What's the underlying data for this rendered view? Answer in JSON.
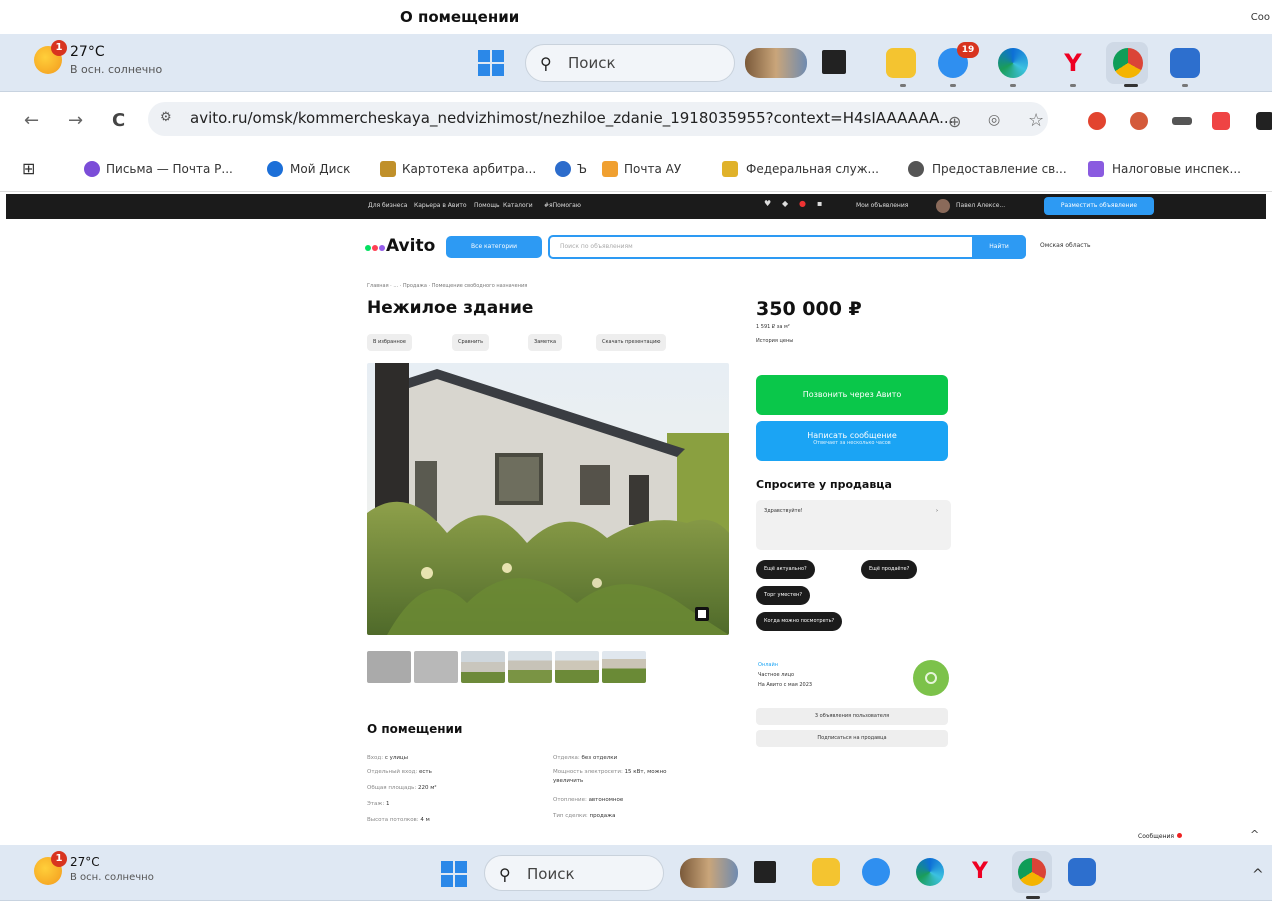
{
  "window": {
    "title": "О помещении",
    "right_clip": "Coo"
  },
  "taskbar": {
    "weather_temp": "27°C",
    "weather_desc": "В осн. солнечно",
    "weather_badge": "1",
    "search_label": "Поиск",
    "badge_count": "19",
    "tray_arrow": "^"
  },
  "browser": {
    "back": "←",
    "forward": "→",
    "reload": "C",
    "url": "avito.ru/omsk/kommercheskaya_nedvizhimost/nezhiloe_zdanie_1918035955?context=H4sIAAAAAA...",
    "zoom_icon": "⊕",
    "star_icon": "☆",
    "apps_icon": "⊞"
  },
  "bookmarks": [
    "Письма — Почта Р...",
    "Мой Диск",
    "Картотека арбитра...",
    "Ъ",
    "Почта АУ",
    "Федеральная служ...",
    "Предоставление св...",
    "Налоговые инспек..."
  ],
  "avito_nav": {
    "links": [
      "Для бизнеса",
      "Карьера в Авито",
      "Помощь",
      "Каталоги",
      "#яПомогаю"
    ],
    "my_ads": "Мои объявления",
    "user": "Павел Алексе...",
    "post_ad": "Разместить объявление"
  },
  "avito_header": {
    "logo": "Avito",
    "all_categories": "Все категории",
    "search_placeholder": "Поиск по объявлениям",
    "find": "Найти",
    "region": "Омская область"
  },
  "listing": {
    "breadcrumbs": "Главная · ... · Продажа · Помещение свободного назначения",
    "title": "Нежилое здание",
    "actions": [
      "В избранное",
      "Сравнить",
      "Заметка",
      "Скачать презентацию"
    ],
    "price": "350 000 ₽",
    "price_per_m2": "1 591 ₽ за м²",
    "price_history": "История цены",
    "call_button": "Позвонить через Авито",
    "message_button": "Написать сообщение",
    "message_sub": "Отвечает за несколько часов",
    "ask_title": "Спросите у продавца",
    "ask_placeholder": "Здравствуйте!",
    "quick_questions": [
      "Ещё актуально?",
      "Торг уместен?",
      "Когда можно посмотреть?"
    ],
    "question_chip_2": "Ещё продаёте?",
    "seller_status": "Онлайн",
    "seller_type": "Частное лицо",
    "seller_since": "На Авито с мая 2023",
    "subscribe": "Подписаться на продавца",
    "ask_about_ad": "3 объявления пользователя"
  },
  "about": {
    "title": "О помещении",
    "left": [
      {
        "k": "Вход:",
        "v": "с улицы"
      },
      {
        "k": "Отдельный вход:",
        "v": "есть"
      },
      {
        "k": "Общая площадь:",
        "v": "220 м²"
      },
      {
        "k": "Этаж:",
        "v": "1"
      },
      {
        "k": "Высота потолков:",
        "v": "4 м"
      }
    ],
    "right": [
      {
        "k": "Отделка:",
        "v": "без отделки"
      },
      {
        "k": "Мощность электросети:",
        "v": "15 кВт, можно"
      },
      {
        "k": "",
        "v": "увеличить"
      },
      {
        "k": "Отопление:",
        "v": "автономное"
      },
      {
        "k": "Тип сделки:",
        "v": "продажа"
      }
    ]
  },
  "messages_widget": {
    "label": "Сообщения",
    "chevron": "^"
  }
}
